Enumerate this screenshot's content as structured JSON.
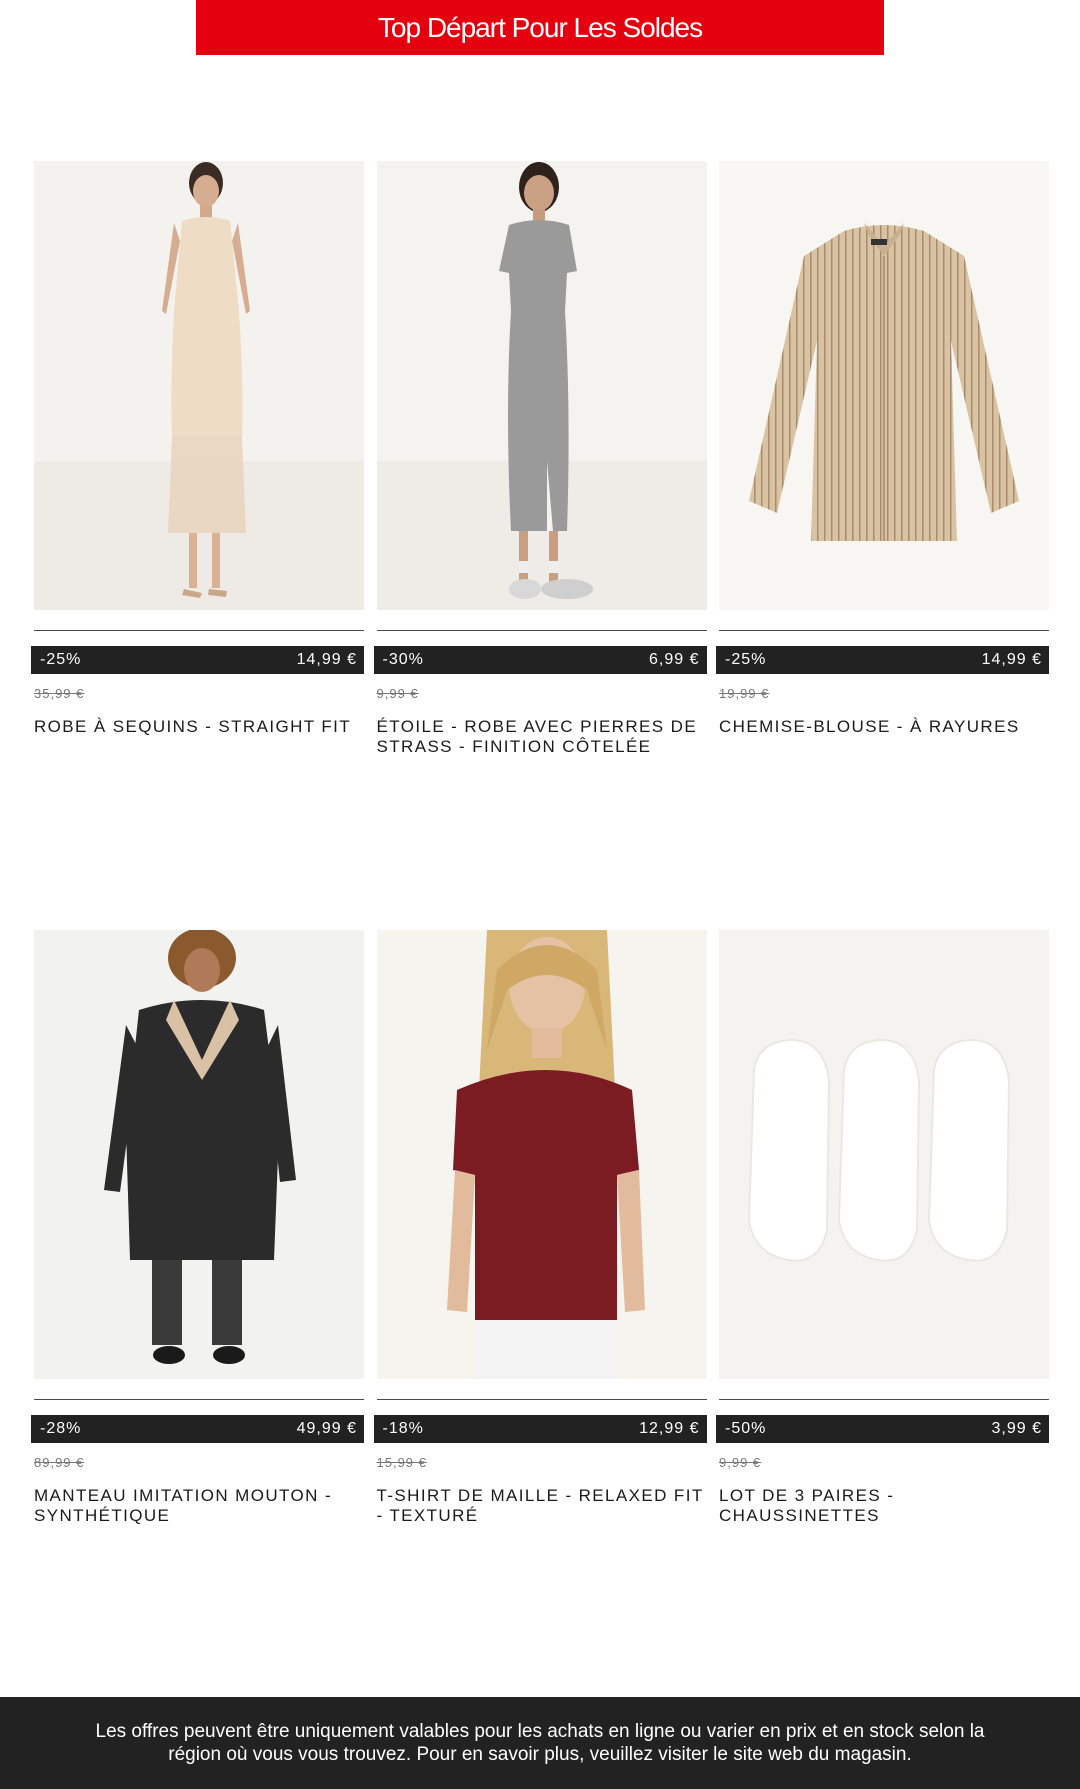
{
  "banner": {
    "title": "Top Départ Pour Les Soldes"
  },
  "products": [
    {
      "discount": "-25%",
      "price": "14,99 €",
      "old_price": "35,99 €",
      "name": "ROBE À SEQUINS - STRAIGHT FIT",
      "image_icon": "sequin-dress-photo"
    },
    {
      "discount": "-30%",
      "price": "6,99 €",
      "old_price": "9,99 €",
      "name": "ÉTOILE - ROBE AVEC PIERRES DE STRASS - FINITION CÔTELÉE",
      "image_icon": "grey-dress-photo"
    },
    {
      "discount": "-25%",
      "price": "14,99 €",
      "old_price": "19,99 €",
      "name": "CHEMISE-BLOUSE - À RAYURES",
      "image_icon": "striped-shirt-photo"
    },
    {
      "discount": "-28%",
      "price": "49,99 €",
      "old_price": "89,99 €",
      "name": "MANTEAU IMITATION MOUTON - SYNTHÉTIQUE",
      "image_icon": "faux-shearling-coat-photo"
    },
    {
      "discount": "-18%",
      "price": "12,99 €",
      "old_price": "15,99 €",
      "name": "T-SHIRT DE MAILLE - RELAXED FIT - TEXTURÉ",
      "image_icon": "knit-tshirt-photo"
    },
    {
      "discount": "-50%",
      "price": "3,99 €",
      "old_price": "9,99 €",
      "name": "LOT DE 3 PAIRES - CHAUSSINETTES",
      "image_icon": "socks-photo"
    }
  ],
  "footer": {
    "text": "Les offres peuvent être uniquement valables pour les achats en ligne ou varier en prix et en stock selon la région où vous vous trouvez. Pour en savoir plus, veuillez visiter le site web du magasin."
  },
  "colors": {
    "banner": "#e50010",
    "price_bar": "#222222",
    "footer": "#222222"
  }
}
